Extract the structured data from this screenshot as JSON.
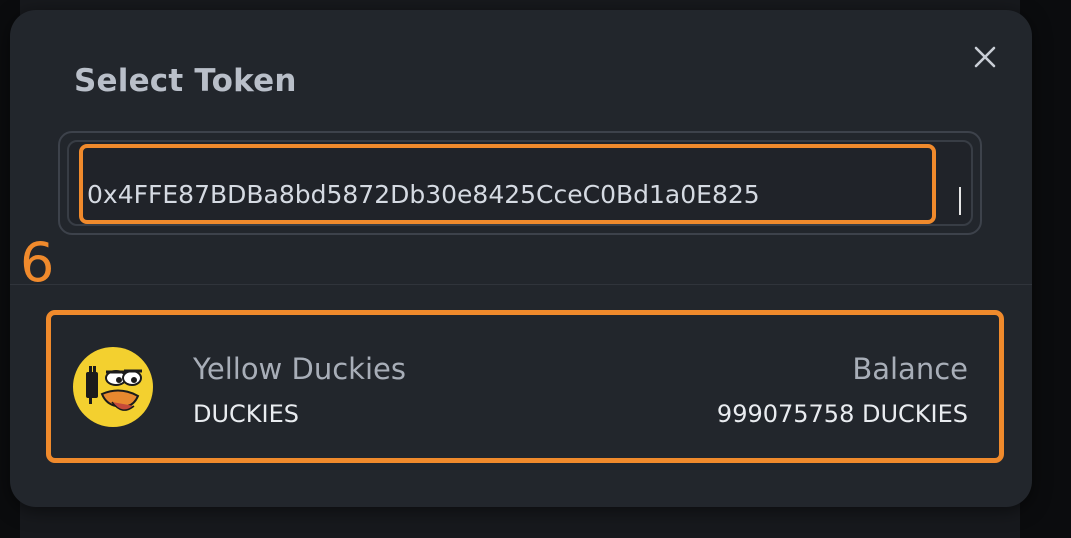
{
  "modal": {
    "title": "Select Token",
    "close_icon": "close-icon"
  },
  "search": {
    "value": "0x4FFE87BDBa8bd5872Db30e8425CceC0Bd1a0E825",
    "placeholder": ""
  },
  "annotation": {
    "step_number": "6",
    "color": "#f08a2c"
  },
  "token": {
    "name": "Yellow Duckies",
    "symbol": "DUCKIES",
    "balance_label": "Balance",
    "balance_value": "999075758 DUCKIES",
    "avatar_icon": "duck-avatar-icon"
  },
  "colors": {
    "modal_bg": "#22262c",
    "accent": "#f08a2c",
    "avatar_yellow": "#f3d02f"
  }
}
